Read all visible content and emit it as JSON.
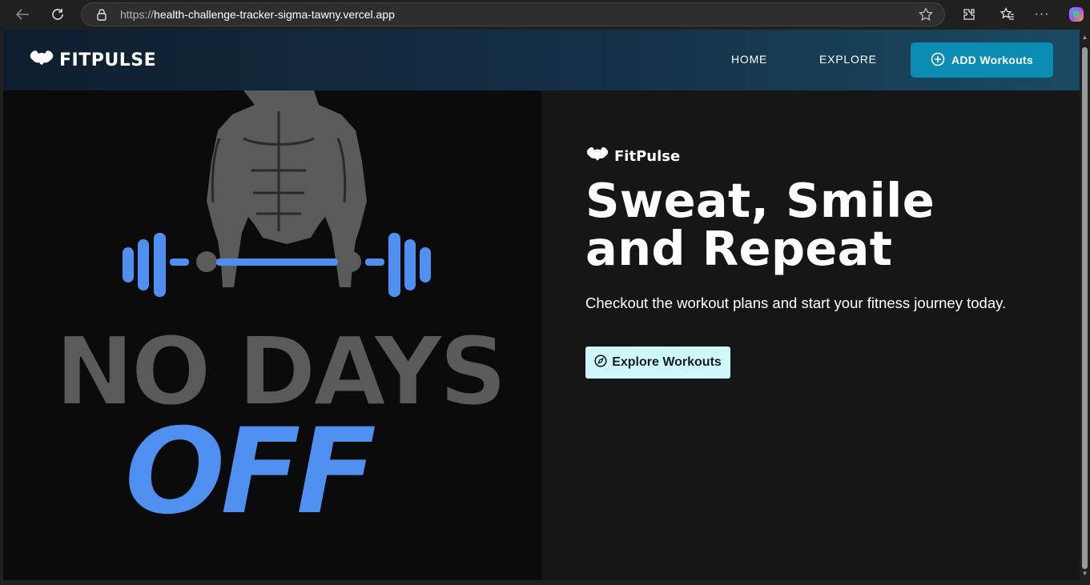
{
  "browser": {
    "url_prefix": "https://",
    "url_host": "health-challenge-tracker-sigma-tawny.vercel.app"
  },
  "navbar": {
    "logo_text": "FITPULSE",
    "links": [
      "HOME",
      "EXPLORE"
    ],
    "cta_label": "ADD Workouts",
    "gradient_start": "#0f1e2f",
    "gradient_end": "#1a4a62",
    "cta_color": "#0b8cb3"
  },
  "hero": {
    "image": {
      "line1": "NO DAYS",
      "line2": "OFF",
      "grey_color": "#5a5a5a",
      "blue_color": "#4f8ff0"
    },
    "brand_text": "FitPulse",
    "headline_line1": "Sweat, Smile",
    "headline_line2": "and Repeat",
    "subtitle": "Checkout the workout plans and start your fitness journey today.",
    "button_label": "Explore Workouts",
    "button_color": "#cff7fb"
  }
}
